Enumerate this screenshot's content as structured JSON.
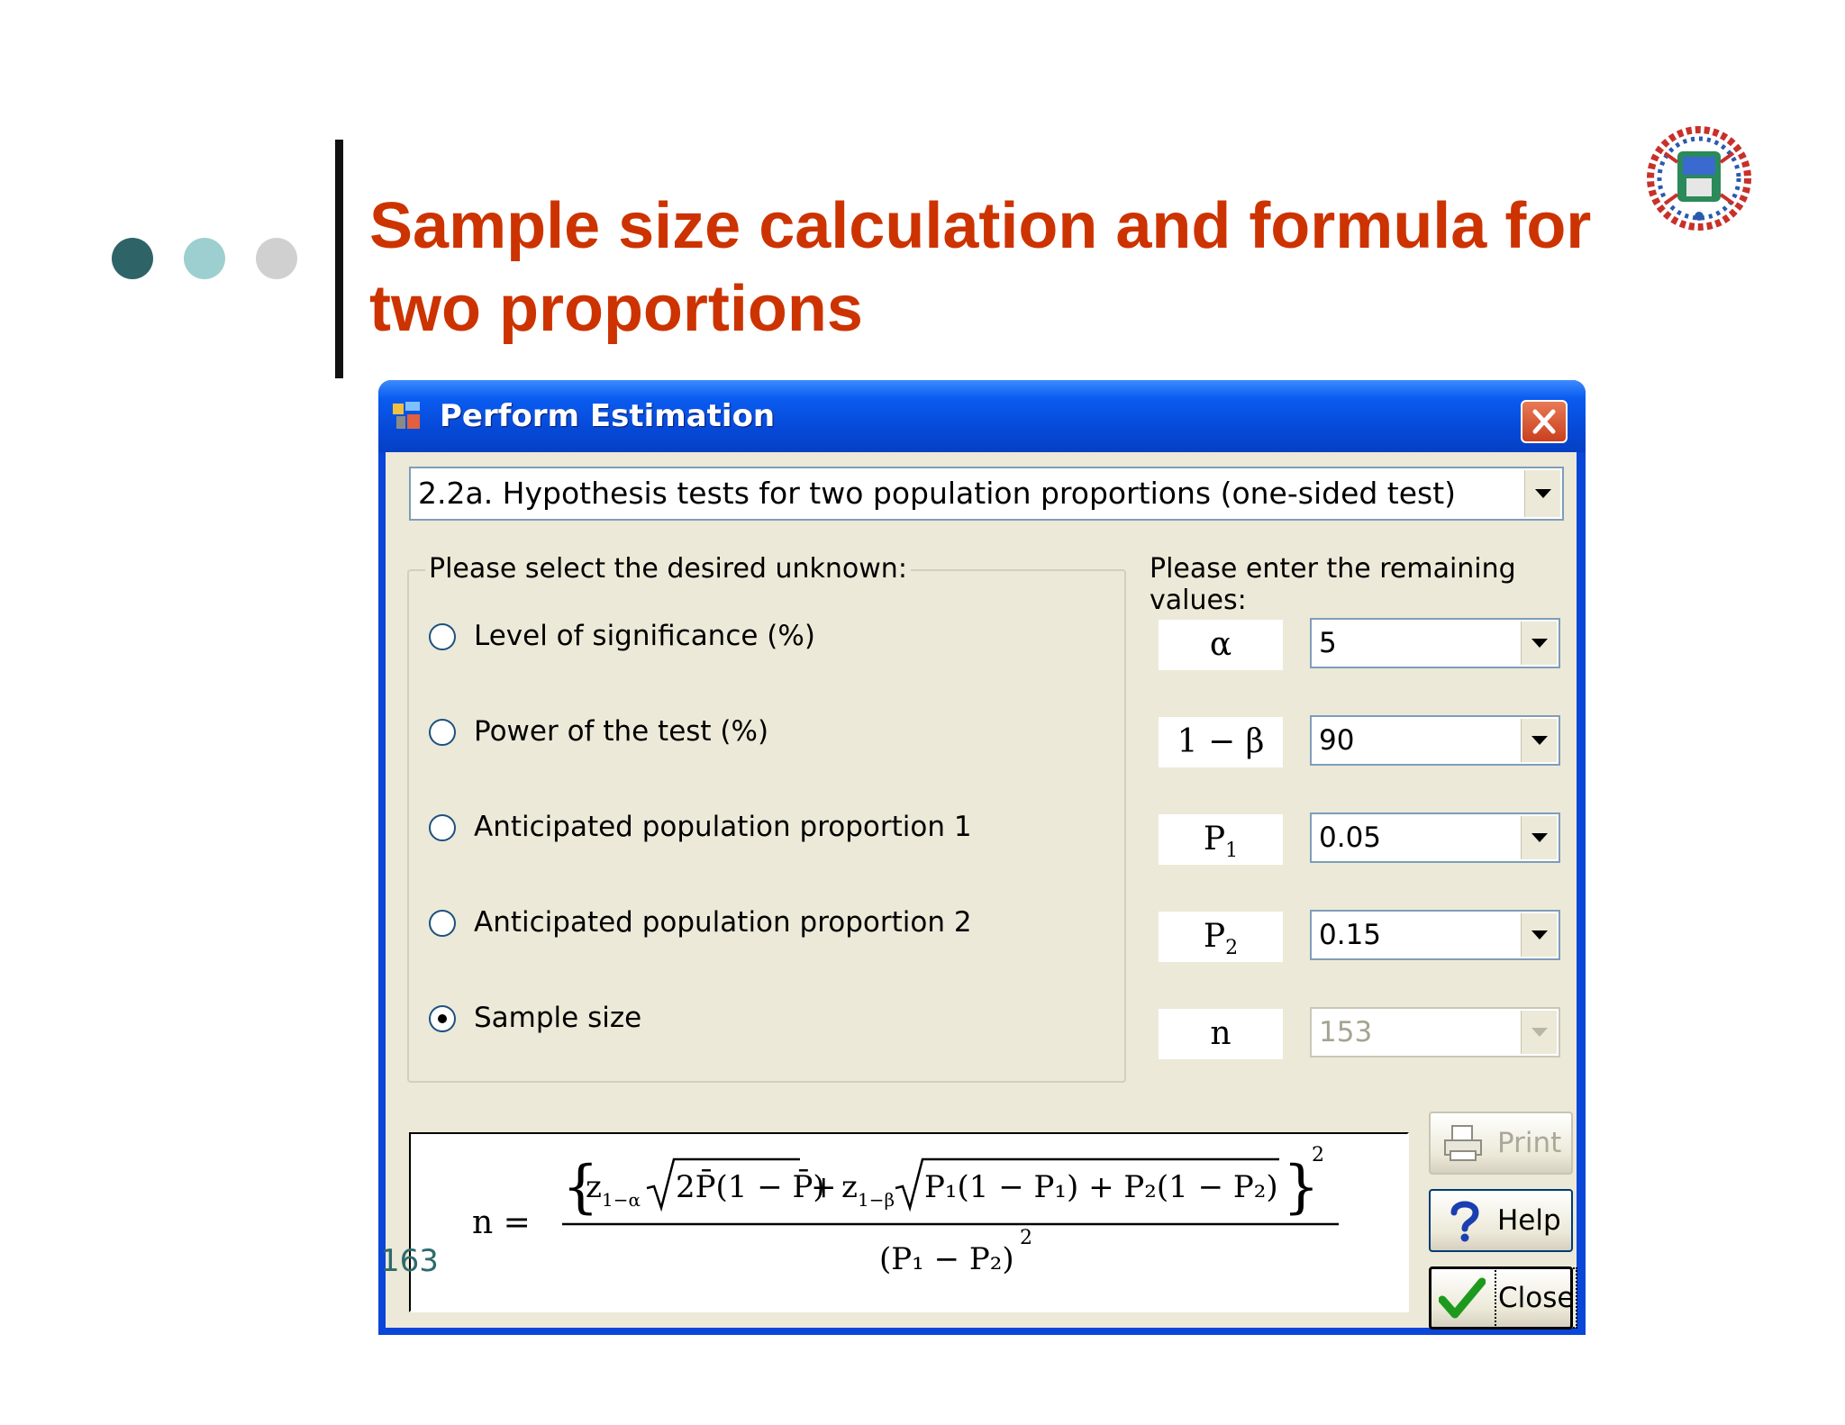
{
  "slide": {
    "title": "Sample size calculation and formula for two proportions",
    "page_number": "163",
    "dot_colors": [
      "#2e6468",
      "#9ecfd0",
      "#d0d0d0"
    ]
  },
  "window": {
    "title": "Perform Estimation",
    "test_select": "2.2a.  Hypothesis tests for two population proportions (one-sided test)",
    "left_group_label": "Please select the desired unknown:",
    "right_group_label": "Please enter the remaining values:",
    "unknowns": [
      {
        "label": "Level of significance (%)",
        "selected": false
      },
      {
        "label": "Power of the test (%)",
        "selected": false
      },
      {
        "label": "Anticipated population proportion 1",
        "selected": false
      },
      {
        "label": "Anticipated population proportion 2",
        "selected": false
      },
      {
        "label": "Sample size",
        "selected": true
      }
    ],
    "inputs": [
      {
        "symbol": "α",
        "value": "5"
      },
      {
        "symbol": "1 − β",
        "value": "90"
      },
      {
        "symbol": "P",
        "symbol_sub": "1",
        "value": "0.05"
      },
      {
        "symbol": "P",
        "symbol_sub": "2",
        "value": "0.15"
      },
      {
        "symbol": "n",
        "value": "153",
        "disabled": true
      }
    ],
    "buttons": {
      "print": "Print",
      "help": "Help",
      "close": "Close"
    },
    "formula": {
      "lhs": "n =",
      "z_alpha": "z",
      "z_alpha_sub": "1−α",
      "two_pbar": "2P̄(1 − P̄)",
      "plus": "+",
      "z_beta": "z",
      "z_beta_sub": "1−β",
      "p_terms": "P₁(1 − P₁) + P₂(1 − P₂)",
      "exponent": "2",
      "denominator": "(P₁ − P₂)",
      "den_exponent": "2"
    }
  }
}
